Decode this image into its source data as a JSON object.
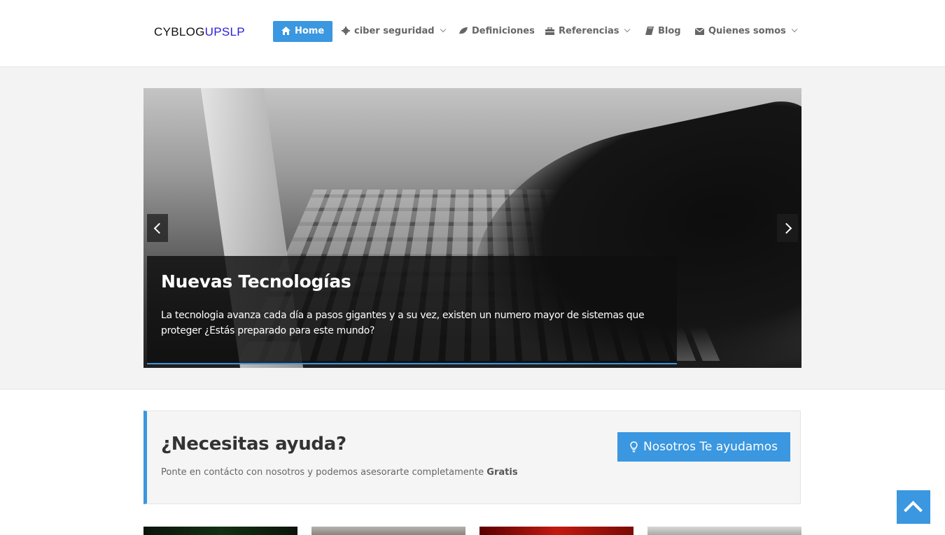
{
  "logo": {
    "part1": "CYBLOG",
    "part2": "UPSLP"
  },
  "nav": {
    "items": [
      {
        "label": "Home",
        "icon": "home-icon",
        "active": true
      },
      {
        "label": "ciber seguridad",
        "icon": "gear-icon",
        "dropdown": true
      },
      {
        "label": "Definiciones",
        "icon": "leaf-icon"
      },
      {
        "label": "Referencias",
        "icon": "briefcase-icon",
        "dropdown": true
      },
      {
        "label": "Blog",
        "icon": "book-icon"
      },
      {
        "label": "Quienes somos",
        "icon": "envelope-icon",
        "dropdown": true
      }
    ]
  },
  "slider": {
    "title": "Nuevas Tecnologías",
    "text": "La tecnologia avanza cada día a pasos gigantes y a su vez, existen un numero mayor de sistemas que proteger ¿Estás preparado para este mundo?"
  },
  "help": {
    "title": "¿Necesitas ayuda?",
    "text": "Ponte en contácto con nosotros y podemos asesorarte completamente",
    "text_bold": "Gratis",
    "button_label": "Nosotros Te ayudamos"
  },
  "colors": {
    "accent": "#3a97e0",
    "logo_blue": "#2a1fd8"
  }
}
